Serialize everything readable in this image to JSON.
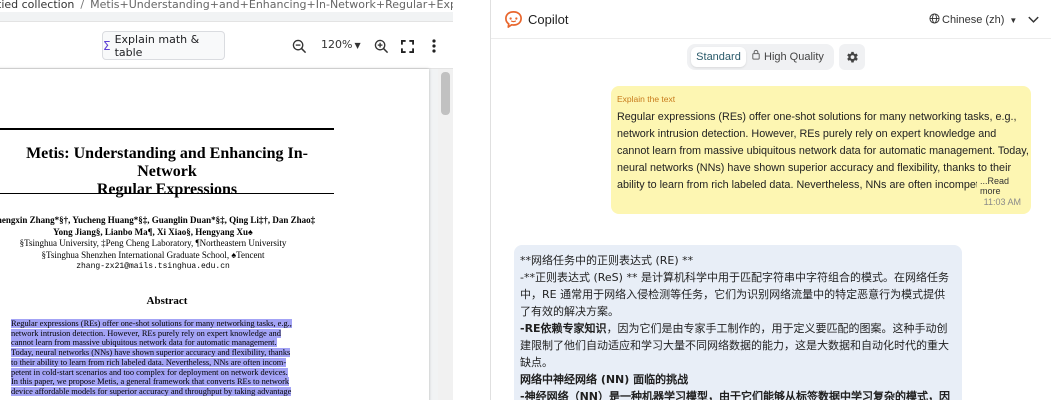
{
  "viewer": {
    "breadcrumb": {
      "link": "tied collection",
      "separator": "/",
      "current": "Metis+Understanding+and+Enhancing+In-Network+Regular+Expression..."
    },
    "toolbar": {
      "explain_label": "Explain math & table",
      "zoom_level": "120%"
    },
    "page": {
      "title_line1": "Metis: Understanding and Enhancing In-Network",
      "title_line2": "Regular Expressions",
      "authors_line1": "Zhengxin Zhang*§†, Yucheng Huang*§‡, Guanglin Duan*§‡, Qing Li‡†, Dan Zhao‡",
      "authors_line2": "Yong Jiang§, Lianbo Ma¶, Xi Xiao§, Hengyang Xu♠",
      "affil_line1": "§Tsinghua University, ‡Peng Cheng Laboratory, ¶Northeastern University",
      "affil_line2": "§Tsinghua Shenzhen International Graduate School, ♠Tencent",
      "email": "zhang-zx21@mails.tsinghua.edu.cn",
      "abstract_heading": "Abstract",
      "abstract_lines": [
        "Regular expressions (REs) offer one-shot solutions for many networking tasks, e.g.,",
        "network intrusion detection. However, REs purely rely on expert knowledge and",
        "cannot learn from massive ubiquitous network data for automatic management.",
        "Today, neural networks (NNs) have shown superior accuracy and flexibility, thanks",
        "to their ability to learn from rich labeled data. Nevertheless, NNs are often incom-",
        "petent in cold-start scenarios and too complex for deployment on network devices.",
        "In this paper, we propose Metis, a general framework that converts REs to network",
        "device affordable models for superior accuracy and throughput by taking advantage"
      ]
    }
  },
  "copilot": {
    "title": "Copilot",
    "language": "Chinese (zh)",
    "modes": {
      "standard": "Standard",
      "high_quality": "High Quality"
    },
    "user_message": {
      "label": "Explain the text",
      "text": "Regular expressions (REs) offer one-shot solutions for many networking tasks, e.g., network intrusion detection. However, REs purely rely on expert knowledge and cannot learn from massive ubiquitous network data for automatic management. Today, neural networks (NNs) have shown superior accuracy and flexibility, thanks to their ability to learn from rich labeled data. Nevertheless, NNs are often incompetent in cold-start scenarios and too complex for deployment on network devices.",
      "read_more": "...Read more",
      "time": "11:03 AM"
    },
    "bot_message": {
      "line1": "**网络任务中的正则表达式 (RE) **",
      "line2": "-**正则表达式 (ReS) ** 是计算机科学中用于匹配字符串中字符组合的模式。在网络任务",
      "line3": "中，RE 通常用于网络入侵检测等任务，它们为识别网络流量中的特定恶意行为模式提供",
      "line4": "了有效的解决方案。",
      "line5_bold": "-RE依赖专家知识",
      "line5_rest": "，因为它们是由专家手工制作的，用于定义要匹配的图案。这种手动创",
      "line6": "建限制了他们自动适应和学习大量不同网络数据的能力，这是大数据和自动化时代的重大",
      "line7": "缺点。",
      "line8": "网络中神经网络 (NN) 面临的挑战",
      "line9": "-神经网络（NN）是一种机器学习模型，由于它们能够从标签数据中学习复杂的模式，因"
    }
  }
}
